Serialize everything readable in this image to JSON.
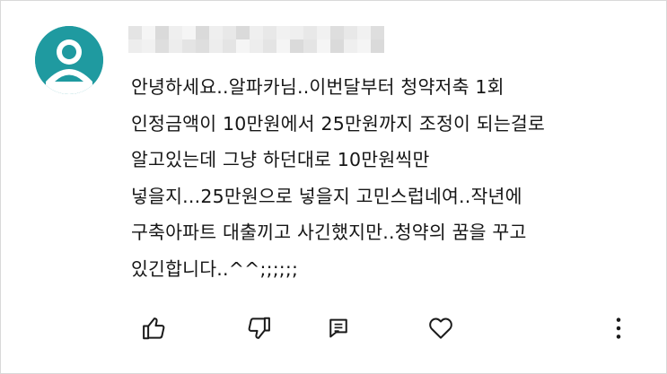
{
  "comment": {
    "lines": [
      "안녕하세요..알파카님..이번달부터 청약저축 1회",
      "인정금액이 10만원에서 25만원까지 조정이 되는걸로",
      "알고있는데 그냥 하던대로 10만원씩만",
      "넣을지...25만원으로 넣을지 고민스럽네여..작년에",
      "구축아파트 대출끼고 사긴했지만..청약의 꿈을 꾸고",
      "있긴합니다..^^;;;;;;"
    ]
  },
  "icons": {
    "avatar": "default-user-icon",
    "like": "thumbs-up-icon",
    "dislike": "thumbs-down-icon",
    "reply": "reply-comment-icon",
    "heart": "heart-icon",
    "more": "more-vertical-icon"
  },
  "colors": {
    "avatar_bg": "#1f9aa0",
    "text": "#161616",
    "border": "#d9d9d9"
  }
}
